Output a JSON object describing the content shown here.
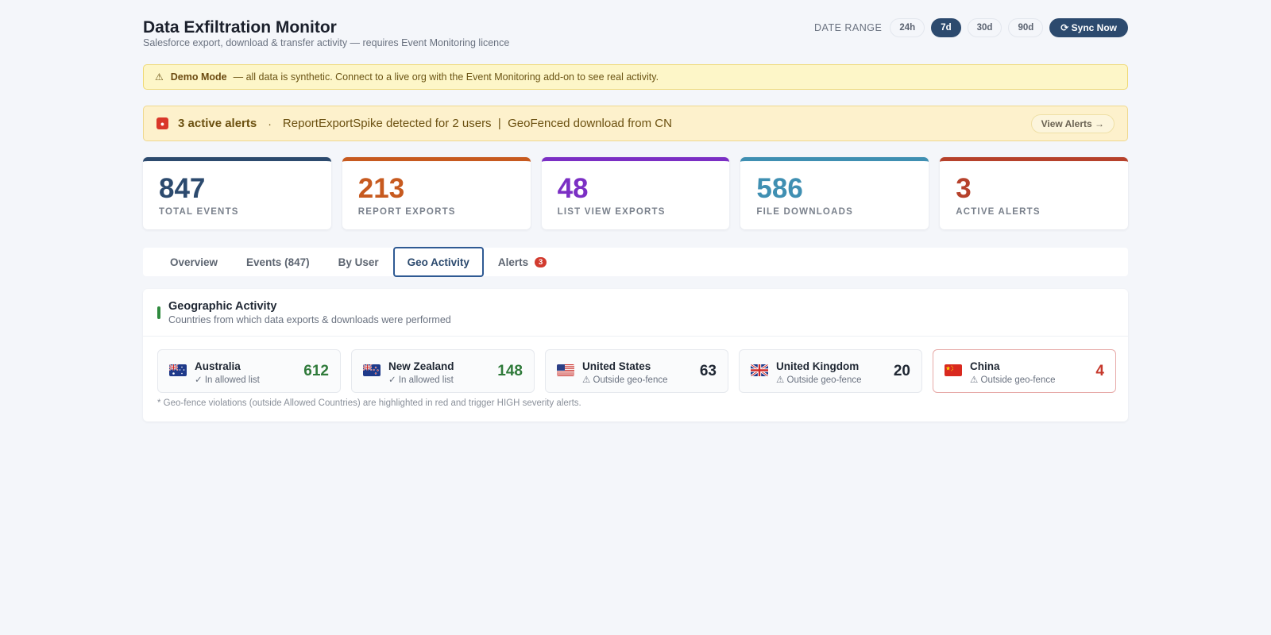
{
  "header": {
    "title": "Data Exfiltration Monitor",
    "subtitle": "Salesforce export, download & transfer activity — requires Event Monitoring licence",
    "range_label": "DATE RANGE",
    "ranges": [
      "24h",
      "7d",
      "30d",
      "90d"
    ],
    "active_range": "7d",
    "sync_label": "⟳ Sync Now"
  },
  "demo_banner": {
    "icon": "warning-icon",
    "title": "Demo Mode",
    "text": "— all data is synthetic. Connect to a live org with the Event Monitoring add-on to see real activity."
  },
  "alert_banner": {
    "icon": "siren-icon",
    "count_text": "3 active alerts",
    "separator": "·",
    "message": "ReportExportSpike detected for 2 users  |  GeoFenced download from CN",
    "action_label": "View Alerts →"
  },
  "stats": [
    {
      "value": "847",
      "label": "TOTAL EVENTS",
      "color": "#2c4a6e"
    },
    {
      "value": "213",
      "label": "REPORT EXPORTS",
      "color": "#c75a1f"
    },
    {
      "value": "48",
      "label": "LIST VIEW EXPORTS",
      "color": "#7b2fc4"
    },
    {
      "value": "586",
      "label": "FILE DOWNLOADS",
      "color": "#3f8fb2"
    },
    {
      "value": "3",
      "label": "ACTIVE ALERTS",
      "color": "#b6412b"
    }
  ],
  "tabs": [
    {
      "label": "Overview"
    },
    {
      "label": "Events (847)"
    },
    {
      "label": "By User"
    },
    {
      "label": "Geo Activity"
    },
    {
      "label": "Alerts",
      "badge": "3"
    }
  ],
  "active_tab": "Geo Activity",
  "geo": {
    "title": "Geographic Activity",
    "subtitle": "Countries from which data exports & downloads were performed",
    "countries": [
      {
        "name": "Australia",
        "status": "✓ In allowed list",
        "value": "612",
        "flag": "australia-flag-icon",
        "value_color": "#2f7a3a"
      },
      {
        "name": "New Zealand",
        "status": "✓ In allowed list",
        "value": "148",
        "flag": "new-zealand-flag-icon",
        "value_color": "#2f7a3a"
      },
      {
        "name": "United States",
        "status": "⚠ Outside geo-fence",
        "value": "63",
        "flag": "united-states-flag-icon",
        "value_color": "#1f2733"
      },
      {
        "name": "United Kingdom",
        "status": "⚠ Outside geo-fence",
        "value": "20",
        "flag": "united-kingdom-flag-icon",
        "value_color": "#1f2733"
      },
      {
        "name": "China",
        "status": "⚠ Outside geo-fence",
        "value": "4",
        "flag": "china-flag-icon",
        "value_color": "#c6382c"
      }
    ],
    "footnote": "* Geo-fence violations (outside Allowed Countries) are highlighted in red and trigger HIGH severity alerts."
  }
}
